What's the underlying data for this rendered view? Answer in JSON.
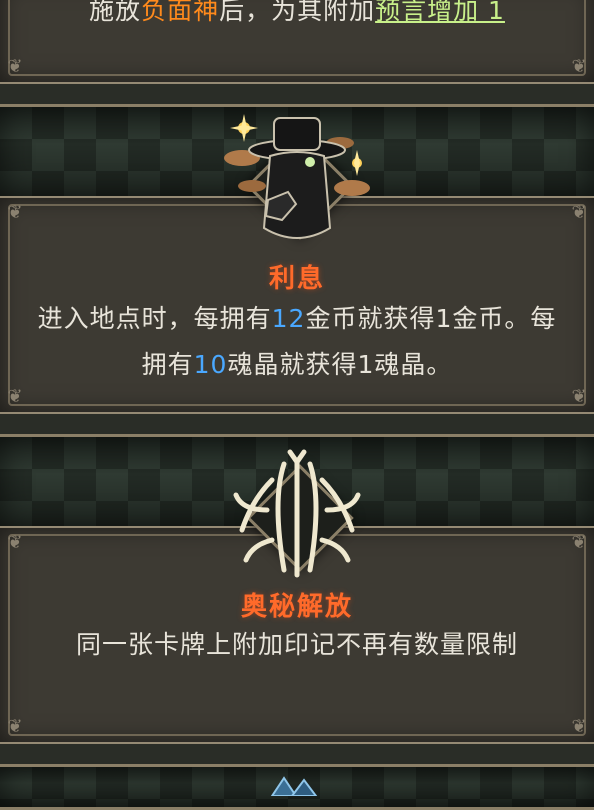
{
  "top_card": {
    "text_prefix": "施放",
    "text_orange": "负面神",
    "text_mid": "后，为其附加",
    "text_green": "预言增加 1"
  },
  "interest_card": {
    "title": "利息",
    "desc_part1": "进入地点时，每拥有",
    "desc_num1": "12",
    "desc_part2": "金币就获得1金币。每拥有",
    "desc_num2": "10",
    "desc_part3": "魂晶就获得1魂晶。",
    "icon": "gambler-coins-icon"
  },
  "arcane_card": {
    "title": "奥秘解放",
    "desc": "同一张卡牌上附加印记不再有数量限制",
    "icon": "white-rune-icon"
  },
  "bottom_icon": "blue-crystal-icon",
  "colors": {
    "title": "#ff6a2a",
    "number_highlight": "#4aa8ff",
    "keyword_orange": "#ff8a1c",
    "keyword_green": "#c8f08a"
  }
}
